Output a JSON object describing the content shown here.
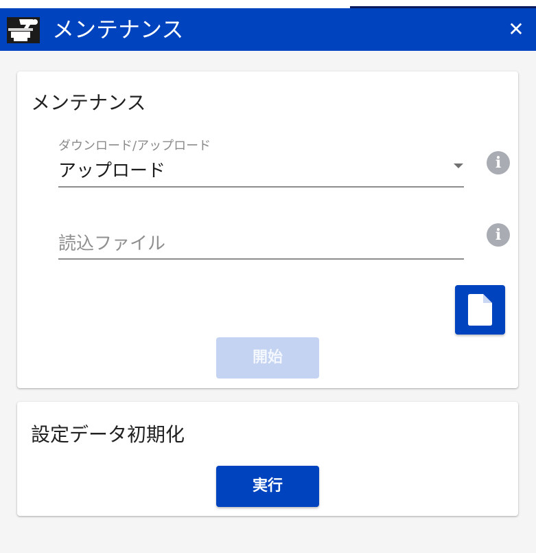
{
  "window": {
    "title": "メンテナンス",
    "close_glyph": "✕",
    "app_icon": "maintenance-app-icon"
  },
  "maintenance_card": {
    "title": "メンテナンス",
    "direction_select": {
      "label": "ダウンロード/アップロード",
      "value": "アップロード",
      "info_glyph": "i"
    },
    "file_field": {
      "placeholder": "読込ファイル",
      "info_glyph": "i"
    },
    "file_button_icon": "file-icon",
    "start_button": {
      "label": "開始",
      "disabled": true
    }
  },
  "reset_card": {
    "title": "設定データ初期化",
    "execute_button": {
      "label": "実行"
    }
  },
  "colors": {
    "accent": "#0043bf",
    "disabled_button": "#c3d3f1",
    "info_icon": "#a9adb3",
    "background": "#f5f5f5"
  }
}
